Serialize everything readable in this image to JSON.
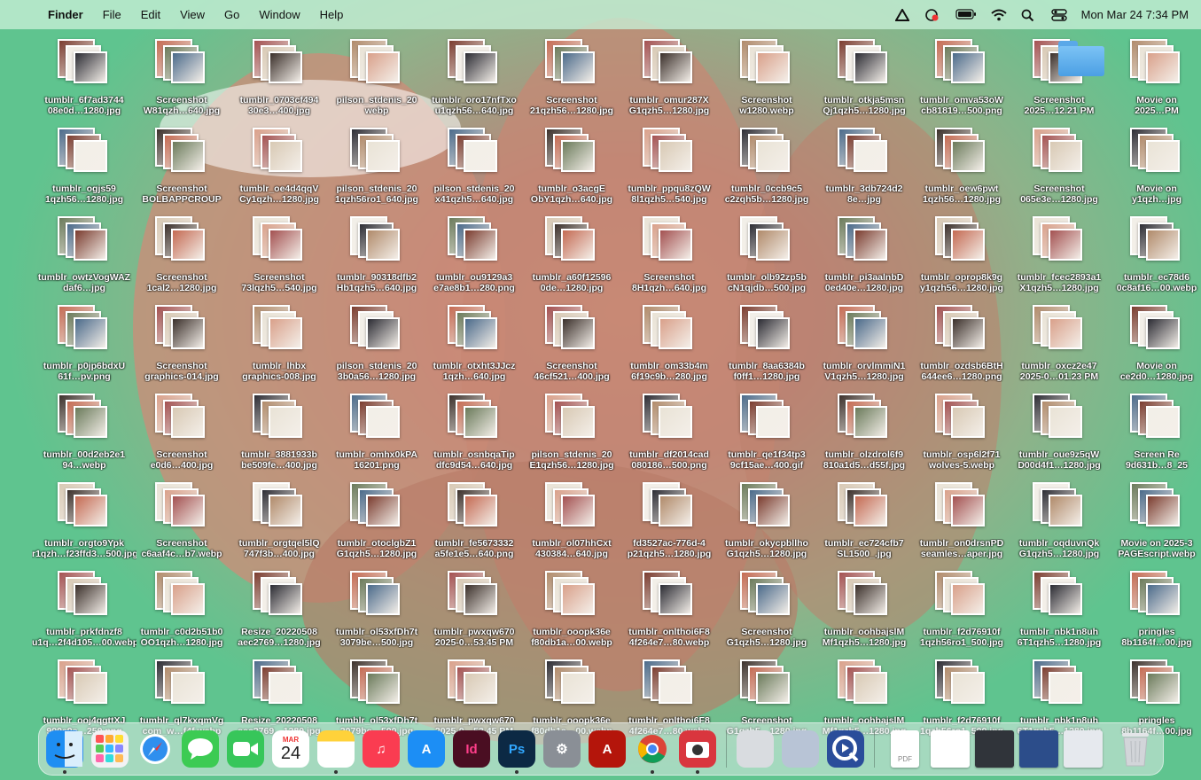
{
  "menubar": {
    "app": "Finder",
    "menus": [
      "File",
      "Edit",
      "View",
      "Go",
      "Window",
      "Help"
    ],
    "clock": "Mon Mar 24  7:34 PM",
    "status_icons": [
      "creative-cloud-icon",
      "screen-recorder-icon",
      "battery-icon",
      "wifi-icon",
      "spotlight-search-icon",
      "control-center-icon"
    ]
  },
  "desktop": {
    "columns": [
      [
        "tumblr_6f7ad3744\n08e0d…1280.jpg",
        "tumblr_ogjs59\n1qzh56…1280.jpg",
        "tumblr_owtzVogWAZ\ndaf6…jpg",
        "tumblr_p0jp6bdxU\n61f…pv.png",
        "tumblr_00d2eb2e1\n94…webp",
        "tumblr_orgto9Ypk\nr1qzh…f23ffd3…500.jpg",
        "tumblr_prkfdnzf8\nu1q…2f4d105…00.webp",
        "tumblr_ooj4qgttXJ\n900e9e…250.png"
      ],
      [
        "Screenshot\nW81qzh…640.jpg",
        "Screenshot\nBOLBAPPCROUP",
        "Screenshot\n1cal2…1280.jpg",
        "Screenshot\ngraphics-014.jpg",
        "Screenshot\ne0d6…400.jpg",
        "Screenshot\nc6aaf4c…b7.webp",
        "tumblr_c0d2b51b0\nOO1qzh…1280.jpg",
        "tumblr_ql7kxqmVg\ncom_w…f4f.webp"
      ],
      [
        "tumblr_0703cf494\n30e3…400.jpg",
        "tumblr_oe4d4qqV\nCy1qzh…1280.jpg",
        "Screenshot\n73lqzh5…540.jpg",
        "tumblr_lhbx\ngraphics-008.jpg",
        "tumblr_3881933b\nbe509fe…400.jpg",
        "tumblr_orgtqel5lQ\n747f3b…400.jpg",
        "Resize_20220508\naec2769…1280.jpg",
        "Resize_20220508\naec2769…1280.jpg"
      ],
      [
        "pilson_stdenis_20\nwebp",
        "pilson_stdenis_20\n1qzh56ro1_640.jpg",
        "tumblr_90318dfb2\nHb1qzh5…640.jpg",
        "pilson_stdenis_20\n3b0a56…1280.jpg",
        "tumblr_omhx0kPA\n16201.png",
        "tumblr_otoclgbZ1\nG1qzh5…1280.jpg",
        "tumblr_ol53xfDh7t\n3079be…500.jpg",
        "tumblr_ol53xfDh7t\n3079be…500.jpg"
      ],
      [
        "tumblr_oro17nfTxo\nu1qzh56…640.jpg",
        "pilson_stdenis_20\nx41qzh5…640.jpg",
        "tumblr_ou9129a3\ne7ae8b1…280.png",
        "tumblr_otxht3JJcz\n1qzh…640.jpg",
        "tumblr_osnbqaTip\ndfc9d54…640.jpg",
        "tumblr_fe5673332\na5fe1e5…640.png",
        "tumblr_pwxqw670\n2025-0…53.45 PM",
        "tumblr_pwxqw670\n2025-0…53.45 PM"
      ],
      [
        "Screenshot\n21qzh56…1280.jpg",
        "tumblr_o3acgE\nObY1qzh…640.jpg",
        "tumblr_a60f12596\n0de…1280.jpg",
        "Screenshot\n46cf521…400.jpg",
        "pilson_stdenis_20\nE1qzh56…1280.jpg",
        "tumblr_ol07hhCxt\n430384…640.jpg",
        "tumblr_ooopk36e\nf80db1a…00.webp",
        "tumblr_ooopk36e\nf80db1a…00.webp"
      ],
      [
        "tumblr_omur287X\nG1qzh5…1280.jpg",
        "tumblr_ppqu8zQW\n8l1qzh5…540.jpg",
        "Screenshot\n8H1qzh…640.jpg",
        "tumblr_om33b4m\n6f19c9b…280.jpg",
        "tumblr_df2014cad\n080186…500.png",
        "fd3527ac-776d-4\np21qzh5…1280.jpg",
        "tumblr_onlthoi6F8\n4f264e7…80.webp",
        "tumblr_onlthoi6F8\n4f264e7…80.webp"
      ],
      [
        "Screenshot\nw1280.webp",
        "tumblr_0ccb9c5\nc2zqh5b…1280.jpg",
        "tumblr_olb92zp5b\ncN1qjdb…500.jpg",
        "tumblr_8aa6384b\nf0ff1…1280.jpg",
        "tumblr_qe1f34tp3\n9cf15ae…400.gif",
        "tumblr_okycpbllho\nG1qzh5…1280.jpg",
        "Screenshot\nG1qzh5…1280.jpg",
        "Screenshot\nG1qzh5…1280.jpg"
      ],
      [
        "tumblr_otkja5msn\nQj1qzh5…1280.jpg",
        "tumblr_3db724d2\n8e…jpg",
        "tumblr_pi3aalnbD\n0ed40e…1280.jpg",
        "tumblr_orvlmmiN1\nV1qzh5…1280.jpg",
        "tumblr_olzdrol6f9\n810a1d5…d55f.jpg",
        "tumblr_ec724cfb7\nSL1500_.jpg",
        "tumblr_oohbajslM\nMf1qzh5…1280.jpg",
        "tumblr_oohbajslM\nMf1qzh5…1280.jpg"
      ],
      [
        "tumblr_omva53oW\ncb81819…500.png",
        "tumblr_oew6pwt\n1qzh56…1280.jpg",
        "tumblr_oprop8k9g\ny1qzh56…1280.jpg",
        "tumblr_ozdsb6BtH\n644ee6…1280.png",
        "tumblr_osp6l2f71\nwolves-5.webp",
        "tumblr_on0drsnPD\nseamles…aper.jpg",
        "tumblr_f2d76910f\n1qzh56ro1_500.jpg",
        "tumblr_f2d76910f\n1qzh56ro1_500.jpg"
      ],
      [
        "Screenshot\n2025…12.21 PM",
        "Screenshot\n065e3e…1280.jpg",
        "tumblr_fcec2893a1\nX1qzh5…1280.jpg",
        "tumblr_oxcz2e47\n2025-0…01.23 PM",
        "tumblr_oue9z5qW\nD00d4f1…1280.jpg",
        "tumblr_oqduvnQk\nG1qzh5…1280.jpg",
        "tumblr_nbk1n8uh\n6T1qzh5…1280.jpg",
        "tumblr_nbk1n8uh\n6T1qzh5…1280.jpg"
      ],
      [
        "Movie on\n2025…PM",
        "Movie on\ny1qzh…jpg",
        "tumblr_ec78d6\n0c8af16…00.webp",
        "Movie on\nce2d0…1280.jpg",
        "Screen Re\n9d631b…8_25",
        "Movie on 2025-3\nPAGEscript.webp",
        "pringles\n8b1164f…00.jpg",
        "pringles\n8b1164f…00.jpg"
      ]
    ],
    "folder_icon": "folder-icon"
  },
  "dock": {
    "apps": [
      {
        "name": "finder-icon",
        "label": "",
        "color": "#2f8fee",
        "running": true
      },
      {
        "name": "launchpad-icon",
        "label": "",
        "color": "#ef6f5f",
        "running": false
      },
      {
        "name": "safari-icon",
        "label": "",
        "color": "#3b9be8",
        "running": false
      },
      {
        "name": "messages-icon",
        "label": "",
        "color": "#3ccb53",
        "running": false
      },
      {
        "name": "facetime-icon",
        "label": "",
        "color": "#37c65a",
        "running": false
      },
      {
        "name": "calendar-icon",
        "label": "24",
        "month": "MAR",
        "color": "#ffffff",
        "running": false
      },
      {
        "name": "notes-icon",
        "label": "",
        "color": "#ffd23a",
        "running": true
      },
      {
        "name": "music-icon",
        "label": "♫",
        "color": "#fa3c51",
        "running": false
      },
      {
        "name": "app-store-icon",
        "label": "A",
        "color": "#1c8ef5",
        "running": false
      },
      {
        "name": "indesign-icon",
        "label": "Id",
        "color": "#4a0e22",
        "running": false
      },
      {
        "name": "photoshop-icon",
        "label": "Ps",
        "color": "#0c2944",
        "running": true
      },
      {
        "name": "system-settings-icon",
        "label": "⚙",
        "color": "#8a8f96",
        "running": false
      },
      {
        "name": "acrobat-icon",
        "label": "A",
        "color": "#b4150b",
        "running": false
      },
      {
        "name": "chrome-icon",
        "label": "",
        "color": "#ffffff",
        "running": true
      },
      {
        "name": "photo-booth-icon",
        "label": "",
        "color": "#d9363e",
        "running": true
      }
    ],
    "secondary": [
      {
        "name": "scanner-icon",
        "color": "#d9dce0"
      },
      {
        "name": "preview-icon",
        "color": "#b8c4d6"
      },
      {
        "name": "quicktime-icon",
        "color": "#2a4d9a"
      }
    ],
    "recents": [
      {
        "name": "pdf-document-icon",
        "color": "#ffffff"
      },
      {
        "name": "text-document-icon",
        "color": "#ffffff"
      },
      {
        "name": "photoshop-window-icon",
        "color": "#30343a"
      },
      {
        "name": "chrome-window-icon",
        "color": "#2c4d8a"
      },
      {
        "name": "window-stack-icon",
        "color": "#e6e9ee"
      },
      {
        "name": "trash-icon",
        "color": "#d7dadd"
      }
    ],
    "pdf_label": "PDF"
  }
}
